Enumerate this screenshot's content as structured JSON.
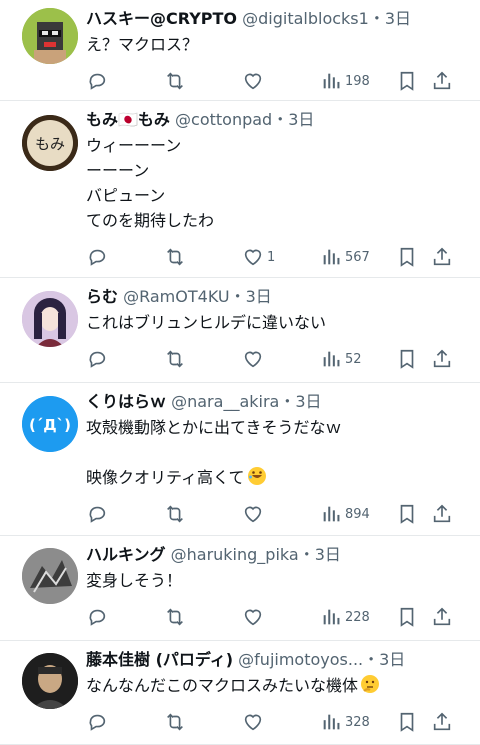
{
  "tweets": [
    {
      "name": "ハスキー@CRYPTO",
      "handle": "@digitalblocks1",
      "time": "・3日",
      "text": "え？マクロス？",
      "likes": "",
      "views": "198"
    },
    {
      "name": "もみ🇯🇵もみ",
      "handle": "@cottonpad",
      "time": "・3日",
      "text": "ウィーーーン\nーーーン\nバピューン\nてのを期待したわ",
      "likes": "1",
      "views": "567"
    },
    {
      "name": "らむ",
      "handle": "@RamOT4KU",
      "time": "・3日",
      "text": "これはブリュンヒルデに違いない",
      "likes": "",
      "views": "52"
    },
    {
      "name": "くりはらｗ",
      "handle": "@nara__akira",
      "time": "・3日",
      "text": "攻殻機動隊とかに出てきそうだなｗ\n\n映像クオリティ高くて",
      "likes": "",
      "views": "894"
    },
    {
      "name": "ハルキング",
      "handle": "@haruking_pika",
      "time": "・3日",
      "text": "変身しそう！",
      "likes": "",
      "views": "228"
    },
    {
      "name": "藤本佳樹 (パロディ)",
      "handle": "@fujimotoyos...",
      "time": "・3日",
      "text": "なんなんだこのマクロスみたいな機体",
      "likes": "",
      "views": "328"
    }
  ],
  "avatar_text": {
    "kuri": "(´Д`)",
    "momi": "もみ"
  },
  "colors": {
    "text": "#0f1419",
    "secondary": "#536471",
    "divider": "#e6e9eb"
  },
  "icons": [
    "reply-icon",
    "retweet-icon",
    "like-icon",
    "views-icon",
    "bookmark-icon",
    "share-icon",
    "emoji-rofl-icon",
    "emoji-thinking-icon"
  ]
}
